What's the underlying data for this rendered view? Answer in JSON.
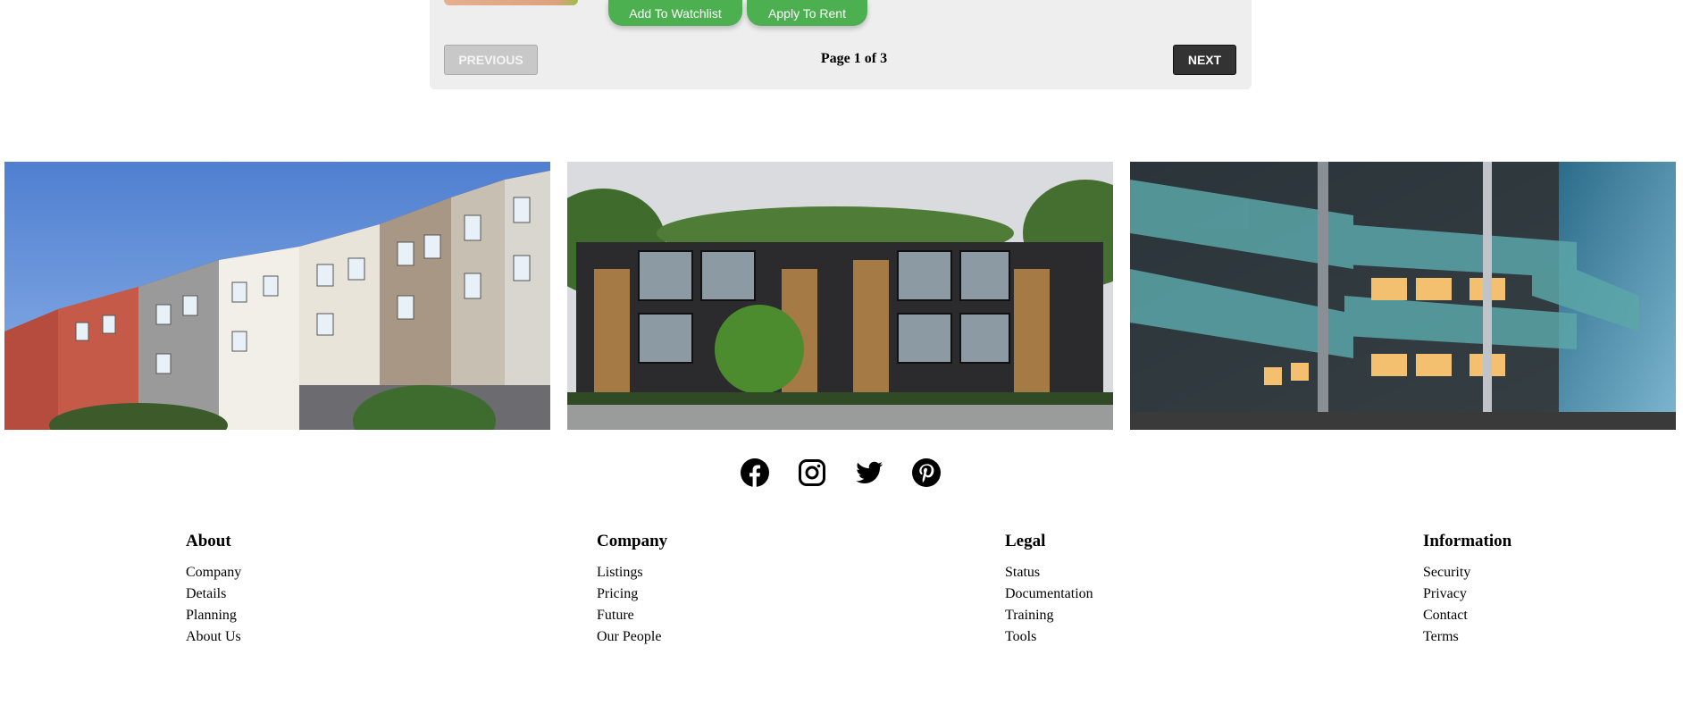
{
  "listing": {
    "watchlist_button": "Add To Watchlist",
    "rent_button": "Apply To Rent"
  },
  "pagination": {
    "previous_label": "PREVIOUS",
    "next_label": "NEXT",
    "page_text": "Page 1 of 3"
  },
  "gallery": {
    "icons": [
      "apartment-building-photo",
      "townhouse-complex-photo",
      "glass-balcony-building-photo"
    ]
  },
  "social": {
    "icons": [
      "facebook-icon",
      "instagram-icon",
      "twitter-icon",
      "pinterest-icon"
    ]
  },
  "footer": {
    "columns": [
      {
        "heading": "About",
        "links": [
          "Company",
          "Details",
          "Planning",
          "About Us"
        ]
      },
      {
        "heading": "Company",
        "links": [
          "Listings",
          "Pricing",
          "Future",
          "Our People"
        ]
      },
      {
        "heading": "Legal",
        "links": [
          "Status",
          "Documentation",
          "Training",
          "Tools"
        ]
      },
      {
        "heading": "Information",
        "links": [
          "Security",
          "Privacy",
          "Contact",
          "Terms"
        ]
      }
    ]
  },
  "colors": {
    "accent_green": "#4caf50",
    "panel_bg": "#eeeeee",
    "next_button": "#333333"
  }
}
